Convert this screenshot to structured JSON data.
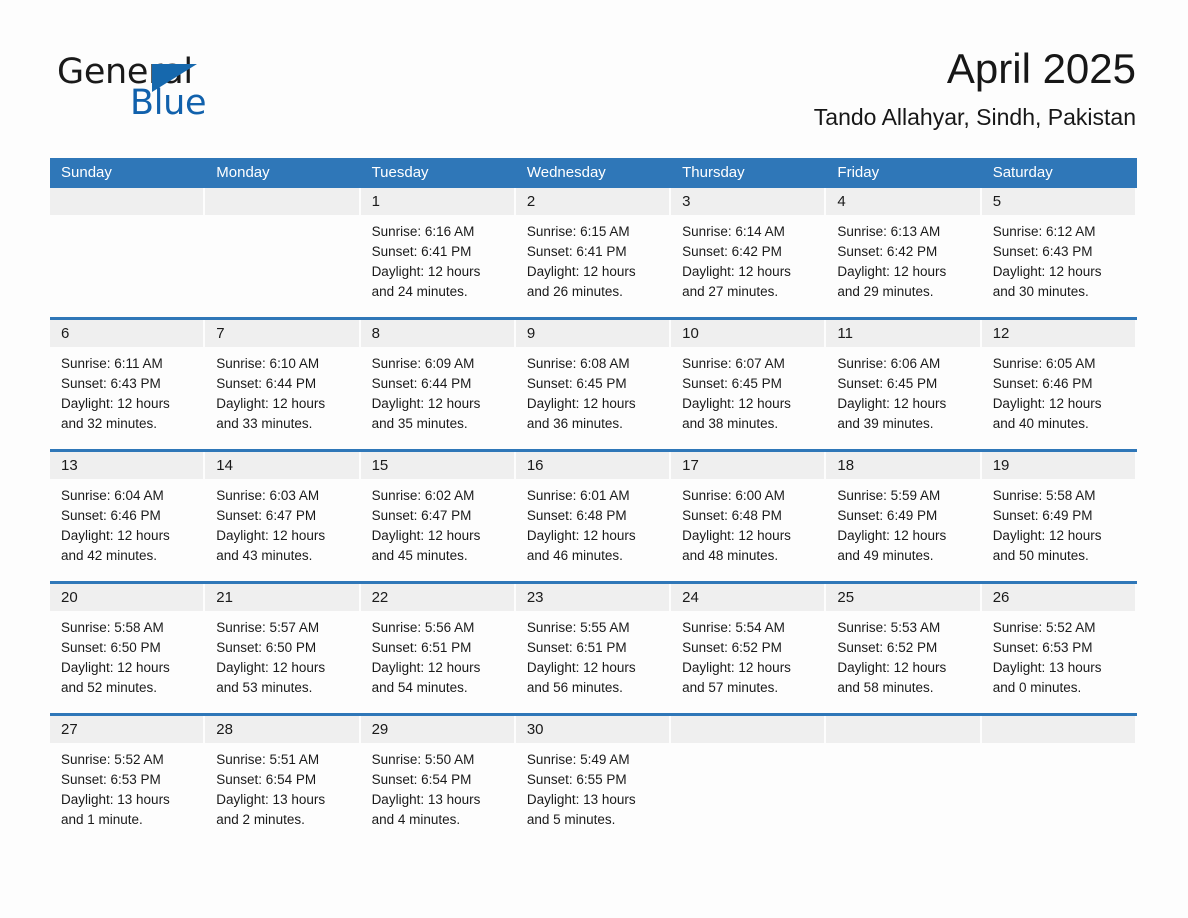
{
  "brand": {
    "word_one": "General",
    "word_two": "Blue",
    "accent_color": "#1668ad"
  },
  "header": {
    "month_year": "April 2025",
    "location": "Tando Allahyar, Sindh, Pakistan",
    "header_bg_color": "#2f77b8",
    "day_band_color": "#efefef"
  },
  "weekdays": [
    "Sunday",
    "Monday",
    "Tuesday",
    "Wednesday",
    "Thursday",
    "Friday",
    "Saturday"
  ],
  "weeks": [
    [
      {
        "day": "",
        "sunrise": "",
        "sunset": "",
        "daylight_line1": "",
        "daylight_line2": ""
      },
      {
        "day": "",
        "sunrise": "",
        "sunset": "",
        "daylight_line1": "",
        "daylight_line2": ""
      },
      {
        "day": "1",
        "sunrise": "Sunrise: 6:16 AM",
        "sunset": "Sunset: 6:41 PM",
        "daylight_line1": "Daylight: 12 hours",
        "daylight_line2": "and 24 minutes."
      },
      {
        "day": "2",
        "sunrise": "Sunrise: 6:15 AM",
        "sunset": "Sunset: 6:41 PM",
        "daylight_line1": "Daylight: 12 hours",
        "daylight_line2": "and 26 minutes."
      },
      {
        "day": "3",
        "sunrise": "Sunrise: 6:14 AM",
        "sunset": "Sunset: 6:42 PM",
        "daylight_line1": "Daylight: 12 hours",
        "daylight_line2": "and 27 minutes."
      },
      {
        "day": "4",
        "sunrise": "Sunrise: 6:13 AM",
        "sunset": "Sunset: 6:42 PM",
        "daylight_line1": "Daylight: 12 hours",
        "daylight_line2": "and 29 minutes."
      },
      {
        "day": "5",
        "sunrise": "Sunrise: 6:12 AM",
        "sunset": "Sunset: 6:43 PM",
        "daylight_line1": "Daylight: 12 hours",
        "daylight_line2": "and 30 minutes."
      }
    ],
    [
      {
        "day": "6",
        "sunrise": "Sunrise: 6:11 AM",
        "sunset": "Sunset: 6:43 PM",
        "daylight_line1": "Daylight: 12 hours",
        "daylight_line2": "and 32 minutes."
      },
      {
        "day": "7",
        "sunrise": "Sunrise: 6:10 AM",
        "sunset": "Sunset: 6:44 PM",
        "daylight_line1": "Daylight: 12 hours",
        "daylight_line2": "and 33 minutes."
      },
      {
        "day": "8",
        "sunrise": "Sunrise: 6:09 AM",
        "sunset": "Sunset: 6:44 PM",
        "daylight_line1": "Daylight: 12 hours",
        "daylight_line2": "and 35 minutes."
      },
      {
        "day": "9",
        "sunrise": "Sunrise: 6:08 AM",
        "sunset": "Sunset: 6:45 PM",
        "daylight_line1": "Daylight: 12 hours",
        "daylight_line2": "and 36 minutes."
      },
      {
        "day": "10",
        "sunrise": "Sunrise: 6:07 AM",
        "sunset": "Sunset: 6:45 PM",
        "daylight_line1": "Daylight: 12 hours",
        "daylight_line2": "and 38 minutes."
      },
      {
        "day": "11",
        "sunrise": "Sunrise: 6:06 AM",
        "sunset": "Sunset: 6:45 PM",
        "daylight_line1": "Daylight: 12 hours",
        "daylight_line2": "and 39 minutes."
      },
      {
        "day": "12",
        "sunrise": "Sunrise: 6:05 AM",
        "sunset": "Sunset: 6:46 PM",
        "daylight_line1": "Daylight: 12 hours",
        "daylight_line2": "and 40 minutes."
      }
    ],
    [
      {
        "day": "13",
        "sunrise": "Sunrise: 6:04 AM",
        "sunset": "Sunset: 6:46 PM",
        "daylight_line1": "Daylight: 12 hours",
        "daylight_line2": "and 42 minutes."
      },
      {
        "day": "14",
        "sunrise": "Sunrise: 6:03 AM",
        "sunset": "Sunset: 6:47 PM",
        "daylight_line1": "Daylight: 12 hours",
        "daylight_line2": "and 43 minutes."
      },
      {
        "day": "15",
        "sunrise": "Sunrise: 6:02 AM",
        "sunset": "Sunset: 6:47 PM",
        "daylight_line1": "Daylight: 12 hours",
        "daylight_line2": "and 45 minutes."
      },
      {
        "day": "16",
        "sunrise": "Sunrise: 6:01 AM",
        "sunset": "Sunset: 6:48 PM",
        "daylight_line1": "Daylight: 12 hours",
        "daylight_line2": "and 46 minutes."
      },
      {
        "day": "17",
        "sunrise": "Sunrise: 6:00 AM",
        "sunset": "Sunset: 6:48 PM",
        "daylight_line1": "Daylight: 12 hours",
        "daylight_line2": "and 48 minutes."
      },
      {
        "day": "18",
        "sunrise": "Sunrise: 5:59 AM",
        "sunset": "Sunset: 6:49 PM",
        "daylight_line1": "Daylight: 12 hours",
        "daylight_line2": "and 49 minutes."
      },
      {
        "day": "19",
        "sunrise": "Sunrise: 5:58 AM",
        "sunset": "Sunset: 6:49 PM",
        "daylight_line1": "Daylight: 12 hours",
        "daylight_line2": "and 50 minutes."
      }
    ],
    [
      {
        "day": "20",
        "sunrise": "Sunrise: 5:58 AM",
        "sunset": "Sunset: 6:50 PM",
        "daylight_line1": "Daylight: 12 hours",
        "daylight_line2": "and 52 minutes."
      },
      {
        "day": "21",
        "sunrise": "Sunrise: 5:57 AM",
        "sunset": "Sunset: 6:50 PM",
        "daylight_line1": "Daylight: 12 hours",
        "daylight_line2": "and 53 minutes."
      },
      {
        "day": "22",
        "sunrise": "Sunrise: 5:56 AM",
        "sunset": "Sunset: 6:51 PM",
        "daylight_line1": "Daylight: 12 hours",
        "daylight_line2": "and 54 minutes."
      },
      {
        "day": "23",
        "sunrise": "Sunrise: 5:55 AM",
        "sunset": "Sunset: 6:51 PM",
        "daylight_line1": "Daylight: 12 hours",
        "daylight_line2": "and 56 minutes."
      },
      {
        "day": "24",
        "sunrise": "Sunrise: 5:54 AM",
        "sunset": "Sunset: 6:52 PM",
        "daylight_line1": "Daylight: 12 hours",
        "daylight_line2": "and 57 minutes."
      },
      {
        "day": "25",
        "sunrise": "Sunrise: 5:53 AM",
        "sunset": "Sunset: 6:52 PM",
        "daylight_line1": "Daylight: 12 hours",
        "daylight_line2": "and 58 minutes."
      },
      {
        "day": "26",
        "sunrise": "Sunrise: 5:52 AM",
        "sunset": "Sunset: 6:53 PM",
        "daylight_line1": "Daylight: 13 hours",
        "daylight_line2": "and 0 minutes."
      }
    ],
    [
      {
        "day": "27",
        "sunrise": "Sunrise: 5:52 AM",
        "sunset": "Sunset: 6:53 PM",
        "daylight_line1": "Daylight: 13 hours",
        "daylight_line2": "and 1 minute."
      },
      {
        "day": "28",
        "sunrise": "Sunrise: 5:51 AM",
        "sunset": "Sunset: 6:54 PM",
        "daylight_line1": "Daylight: 13 hours",
        "daylight_line2": "and 2 minutes."
      },
      {
        "day": "29",
        "sunrise": "Sunrise: 5:50 AM",
        "sunset": "Sunset: 6:54 PM",
        "daylight_line1": "Daylight: 13 hours",
        "daylight_line2": "and 4 minutes."
      },
      {
        "day": "30",
        "sunrise": "Sunrise: 5:49 AM",
        "sunset": "Sunset: 6:55 PM",
        "daylight_line1": "Daylight: 13 hours",
        "daylight_line2": "and 5 minutes."
      },
      {
        "day": "",
        "sunrise": "",
        "sunset": "",
        "daylight_line1": "",
        "daylight_line2": ""
      },
      {
        "day": "",
        "sunrise": "",
        "sunset": "",
        "daylight_line1": "",
        "daylight_line2": ""
      },
      {
        "day": "",
        "sunrise": "",
        "sunset": "",
        "daylight_line1": "",
        "daylight_line2": ""
      }
    ]
  ]
}
